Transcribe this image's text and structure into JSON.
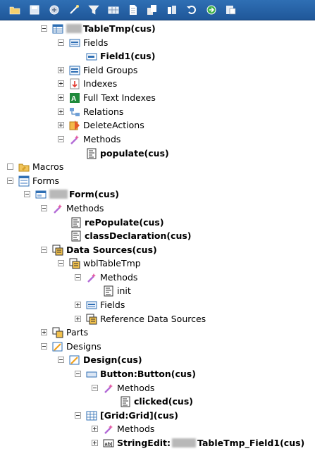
{
  "tree": {
    "table_tmp": "TableTmp(cus)",
    "fields": "Fields",
    "field1": "Field1(cus)",
    "field_groups": "Field Groups",
    "indexes": "Indexes",
    "full_text_indexes": "Full Text Indexes",
    "relations": "Relations",
    "delete_actions": "DeleteActions",
    "methods": "Methods",
    "populate": "populate(cus)",
    "macros": "Macros",
    "forms": "Forms",
    "form": "Form(cus)",
    "form_methods": "Methods",
    "repopulate": "rePopulate(cus)",
    "class_declaration": "classDeclaration(cus)",
    "data_sources": "Data Sources(cus)",
    "wbl_table_tmp": "wblTableTmp",
    "ds_methods": "Methods",
    "init": "init",
    "ds_fields": "Fields",
    "reference_data_sources": "Reference Data Sources",
    "parts": "Parts",
    "designs": "Designs",
    "design": "Design(cus)",
    "button": "Button:Button(cus)",
    "button_methods": "Methods",
    "clicked": "clicked(cus)",
    "grid": "[Grid:Grid](cus)",
    "grid_methods": "Methods",
    "string_edit_prefix": "StringEdit:",
    "string_edit_suffix": "TableTmp_Field1(cus)"
  }
}
